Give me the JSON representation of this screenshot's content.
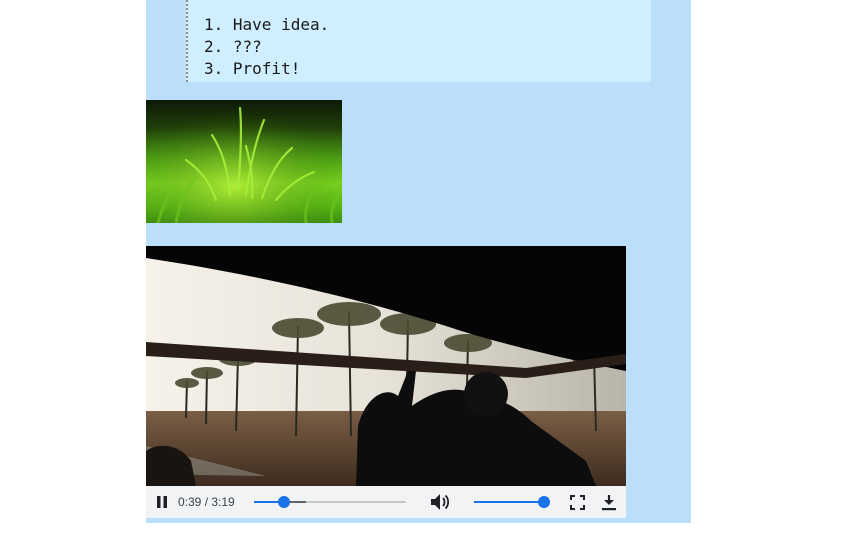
{
  "code_list": {
    "items": [
      "1. Have idea.",
      "2. ???",
      "3. Profit!"
    ]
  },
  "grass_image": {
    "icon": "grass-photo"
  },
  "video": {
    "current_time": "0:39",
    "duration": "3:19",
    "time_display": "0:39 / 3:19",
    "progress_fraction": 0.196,
    "buffered_fraction": 0.34,
    "volume_fraction": 1.0,
    "icons": {
      "play_pause": "pause-icon",
      "volume": "volume-icon",
      "fullscreen": "fullscreen-icon",
      "download": "download-icon"
    }
  },
  "colors": {
    "page_column": "#bbdefb",
    "code_background": "#cfeeff",
    "accent": "#1a73e8",
    "controls_bar": "#f1f3f4"
  }
}
